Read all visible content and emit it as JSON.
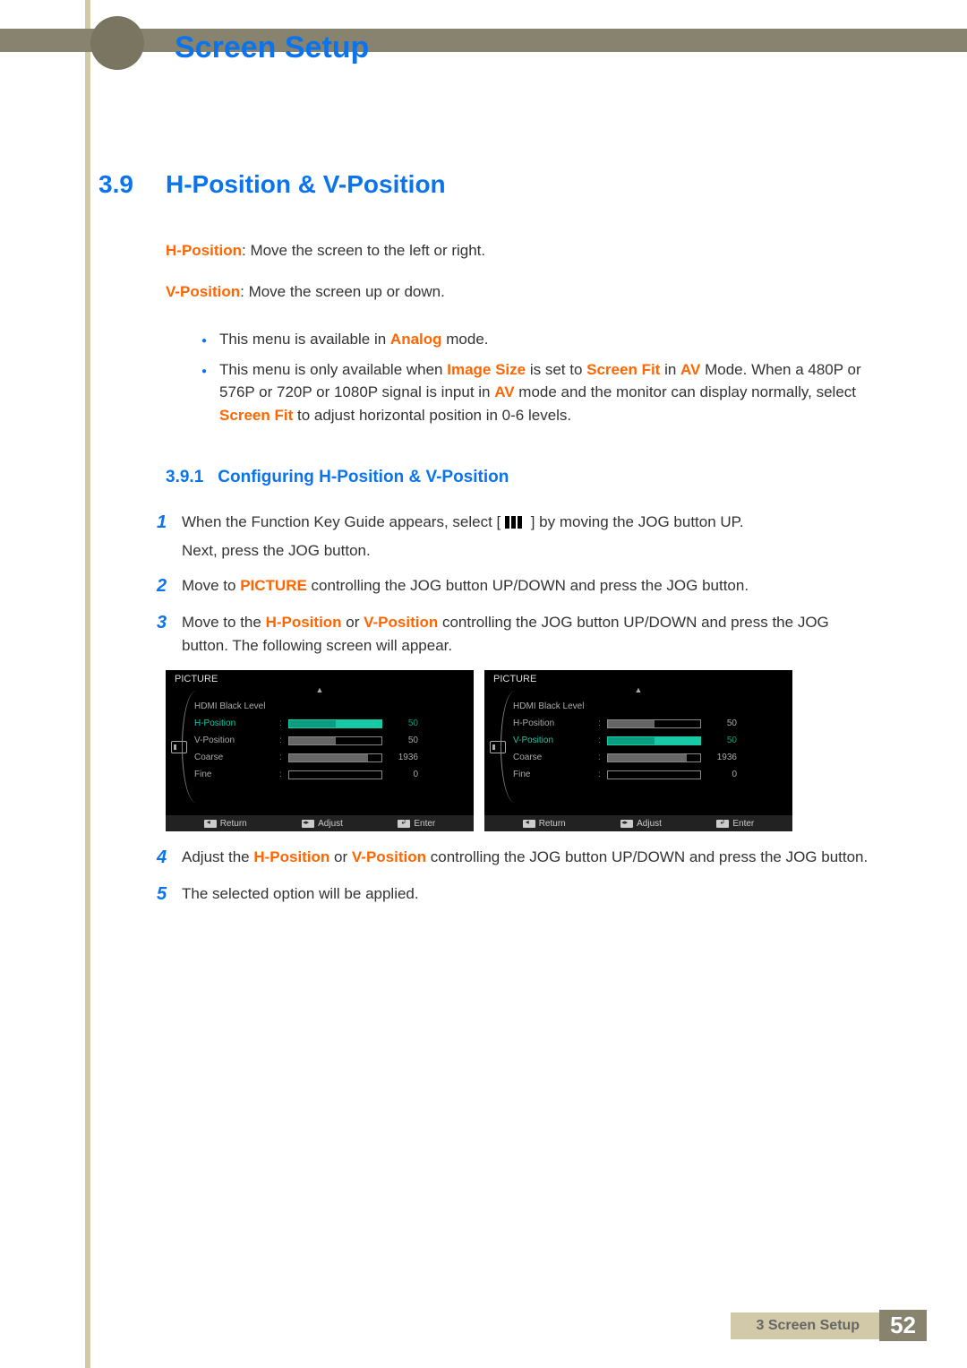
{
  "chapter": {
    "title": "Screen Setup"
  },
  "section": {
    "number": "3.9",
    "title": "H-Position & V-Position"
  },
  "defs": {
    "hpos_label": "H-Position",
    "hpos_text": ": Move the screen to the left or right.",
    "vpos_label": "V-Position",
    "vpos_text": ": Move the screen up or down."
  },
  "notes": {
    "n1_pre": "This menu is available in ",
    "n1_em": "Analog",
    "n1_post": " mode.",
    "n2_a": "This menu is only available when ",
    "n2_b": "Image Size",
    "n2_c": " is set to ",
    "n2_d": "Screen Fit",
    "n2_e": " in ",
    "n2_f": "AV",
    "n2_g": " Mode. When a 480P or 576P or 720P or 1080P signal is input in ",
    "n2_h": "AV",
    "n2_i": " mode and the monitor can display normally, select ",
    "n2_j": "Screen Fit",
    "n2_k": " to adjust horizontal position in 0-6 levels."
  },
  "subsection": {
    "number": "3.9.1",
    "title": "Configuring H-Position & V-Position"
  },
  "steps": {
    "s1a": "When the Function Key Guide appears, select  [",
    "s1b": "]  by moving the JOG button UP.",
    "s1c": "Next, press the JOG button.",
    "s2a": "Move to ",
    "s2b": "PICTURE",
    "s2c": " controlling the JOG button UP/DOWN and press the JOG button.",
    "s3a": "Move to the ",
    "s3b": "H-Position",
    "s3c": " or  ",
    "s3d": "V-Position",
    "s3e": " controlling the JOG button UP/DOWN and press the JOG button. The following screen will appear.",
    "s4a": "Adjust the ",
    "s4b": "H-Position",
    "s4c": " or ",
    "s4d": "V-Position",
    "s4e": " controlling the JOG button UP/DOWN and press the JOG button.",
    "s5": "The selected option will be applied."
  },
  "osd": {
    "title": "PICTURE",
    "rows": {
      "hdmi": "HDMI Black Level",
      "hpos": "H-Position",
      "vpos": "V-Position",
      "coarse": "Coarse",
      "fine": "Fine"
    },
    "vals": {
      "hpos": "50",
      "vpos": "50",
      "coarse": "1936",
      "fine": "0"
    },
    "footer": {
      "return": "Return",
      "adjust": "Adjust",
      "enter": "Enter"
    }
  },
  "footer": {
    "chapter_label": "3 Screen Setup",
    "page": "52"
  }
}
